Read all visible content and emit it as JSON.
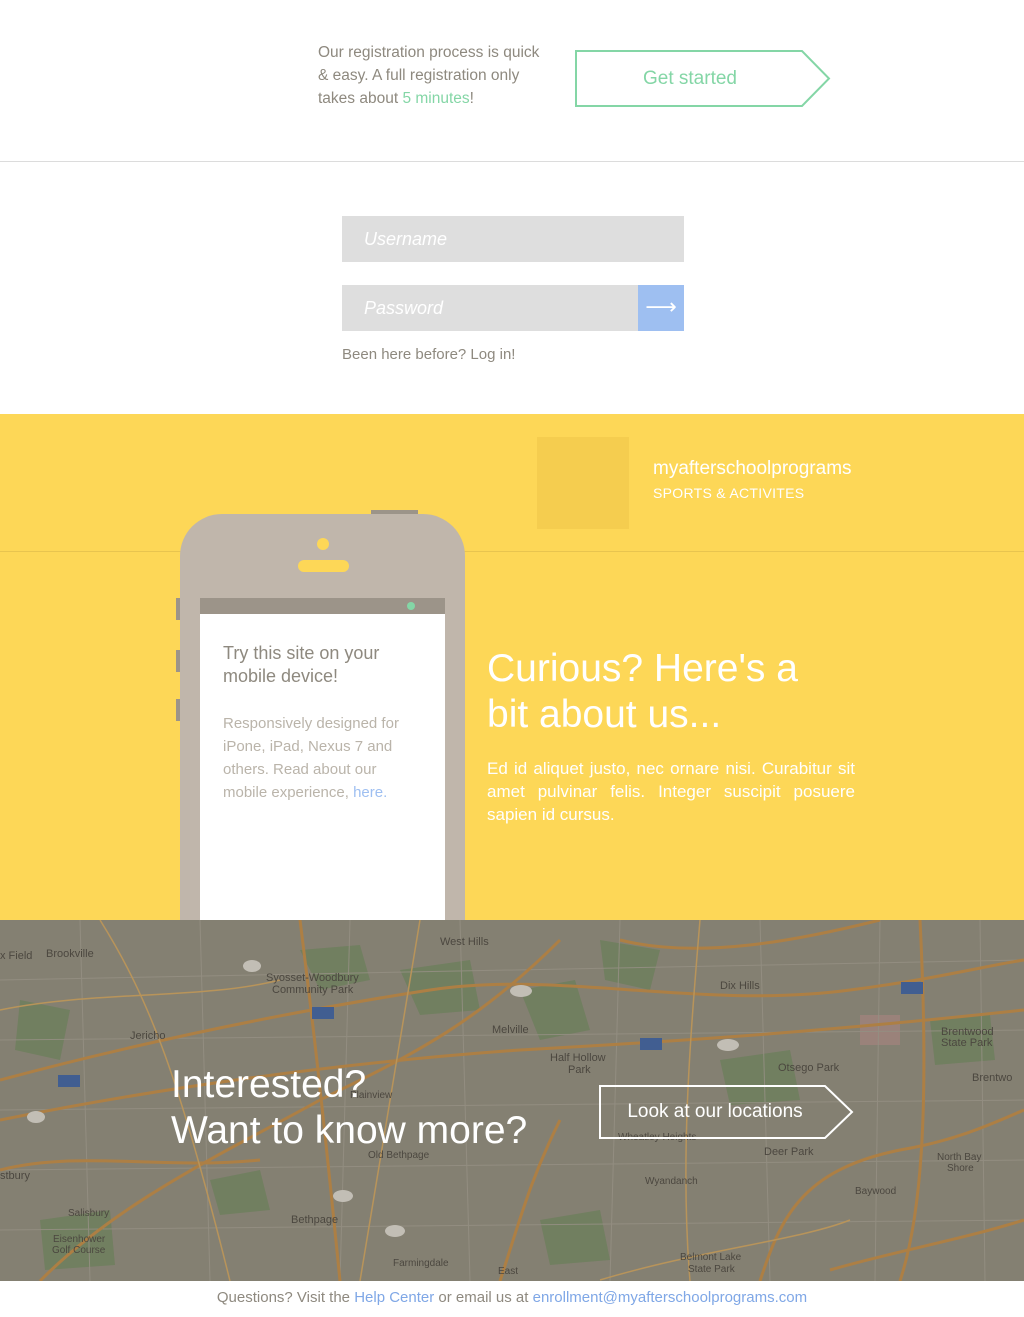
{
  "registration": {
    "text_before": "Our registration process is quick & easy. A full registration only takes about ",
    "highlight": "5 minutes",
    "text_after": "!",
    "button_label": "Get started"
  },
  "login": {
    "username_placeholder": "Username",
    "password_placeholder": "Password",
    "submit_icon": "⟶",
    "login_link": "Been here before? Log in!"
  },
  "brand": {
    "name": "myafterschoolprograms",
    "subtitle": "SPORTS & ACTIVITES"
  },
  "mobile": {
    "title": "Try this site on your mobile device!",
    "body": "Responsively designed for iPone, iPad, Nexus 7 and others. Read about our mobile experience, ",
    "link": "here."
  },
  "about": {
    "title": "Curious? Here's a bit about us...",
    "body": "Ed id aliquet justo, nec ornare nisi. Curabitur sit amet pulvinar felis. Integer suscipit posuere sapien id cursus."
  },
  "map_cta": {
    "line1": "Interested?",
    "line2": "Want to know more?",
    "button_label": "Look at our locations"
  },
  "map_labels": {
    "l1": "Brookville",
    "l2": "West Hills",
    "l3": "Syosset-Woodbury",
    "l4": "Community Park",
    "l5": "Jericho",
    "l6": "Melville",
    "l7": "Half Hollow",
    "l8": "Park",
    "l9": "Dix Hills",
    "l10": "Otsego Park",
    "l11": "Brentwood",
    "l12": "State Park",
    "l13": "Deer Park",
    "l14": "Wyandanch",
    "l15": "North Bay",
    "l16": "Shore",
    "l17": "Baywood",
    "l18": "Bethpage",
    "l19": "Eisenhower",
    "l20": "Golf Course",
    "l21": "Farmingdale",
    "l22": "Belmont Lake",
    "l23": "State Park",
    "l24": "Plainview",
    "l25": "Salisbury",
    "l26": "East",
    "l27": "Brentwo",
    "l28": "x Field",
    "l29": "stbury",
    "l30": "Old Bethpage",
    "l31": "Wheatley Heights"
  },
  "footer": {
    "text1": "Questions? Visit the ",
    "help_link": "Help Center",
    "text2": " or email us at ",
    "email": "enrollment@myafterschoolprograms.com"
  },
  "colors": {
    "accent_green": "#84d6a6",
    "accent_blue": "#9ebff1",
    "yellow": "#fdd757",
    "phone": "#c0b6ab"
  }
}
